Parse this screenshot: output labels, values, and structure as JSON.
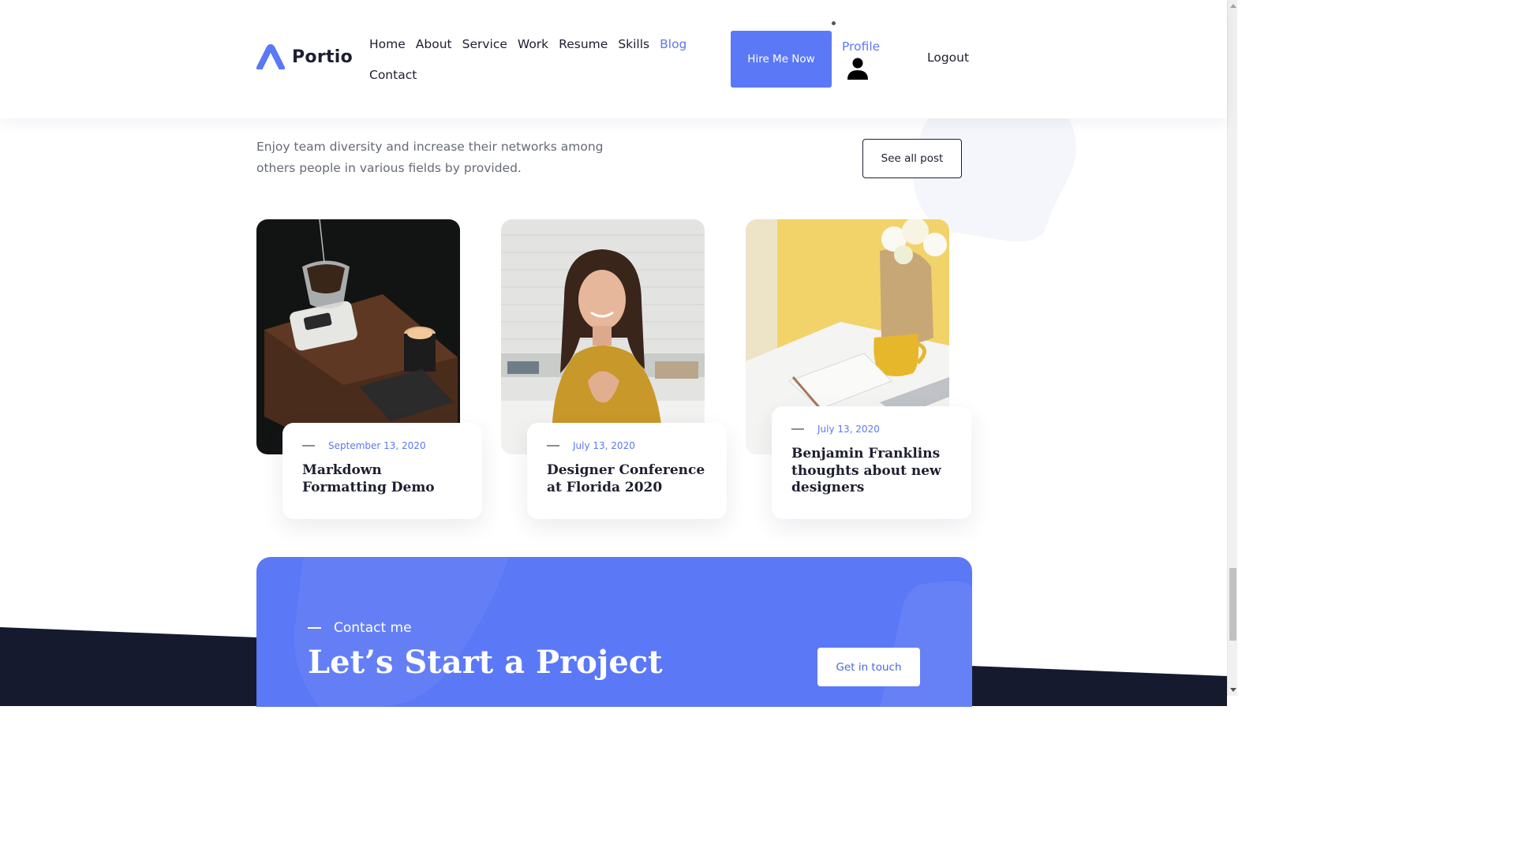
{
  "brand": {
    "name": "Portio",
    "accent": "#5b78f6",
    "dark": "#1d1e30"
  },
  "nav": {
    "row1": [
      "Home",
      "About",
      "Service",
      "Work",
      "Resume",
      "Skills",
      "Blog"
    ],
    "row2": [
      "Contact"
    ],
    "active": "Blog"
  },
  "header": {
    "hire_label": "Hire Me Now",
    "profile_label": "Profile",
    "profile_icon": "person-icon",
    "logout_label": "Logout"
  },
  "blog": {
    "intro": "Enjoy team diversity and increase their networks among others people in various fields by provided.",
    "see_all_label": "See all post",
    "posts": [
      {
        "date": "September 13, 2020",
        "title": "Markdown Formatting Demo",
        "image": "coffee-pour-over-photo"
      },
      {
        "date": "July 13, 2020",
        "title": "Designer Conference at Florida 2020",
        "image": "smiling-woman-photo"
      },
      {
        "date": "July 13, 2020",
        "title": "Benjamin Franklins thoughts about new designers",
        "image": "desk-notebook-cup-photo"
      }
    ]
  },
  "contact": {
    "eyebrow": "Contact me",
    "title": "Let’s Start a Project",
    "button_label": "Get in touch"
  }
}
